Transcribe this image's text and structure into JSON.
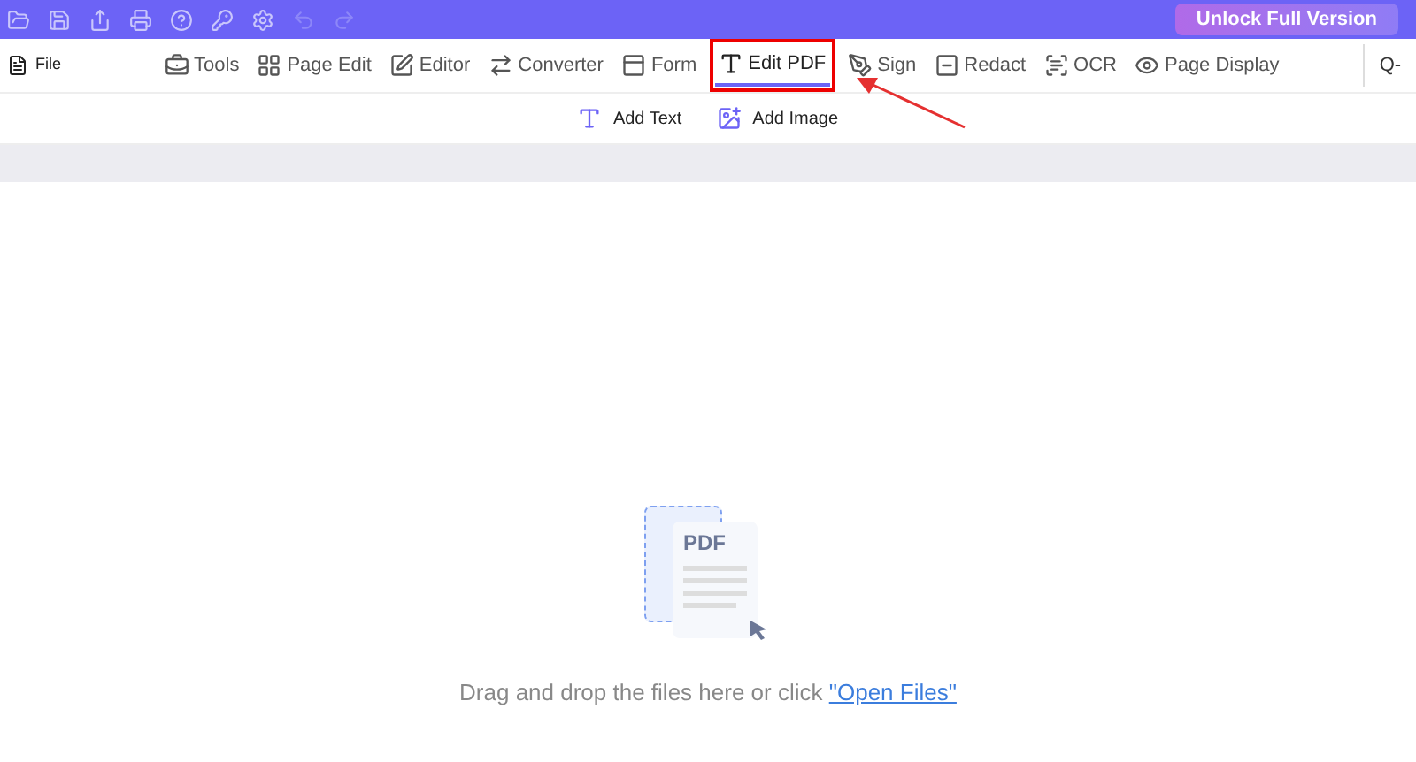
{
  "title_bar": {
    "unlock_button": "Unlock Full Version"
  },
  "file_menu": {
    "label": "File"
  },
  "tabs": [
    {
      "label": "Tools",
      "kind": "tools",
      "selected": false
    },
    {
      "label": "Page Edit",
      "kind": "grid",
      "selected": false
    },
    {
      "label": "Editor",
      "kind": "editor",
      "selected": false
    },
    {
      "label": "Converter",
      "kind": "convert",
      "selected": false
    },
    {
      "label": "Form",
      "kind": "form",
      "selected": false
    },
    {
      "label": "Edit PDF",
      "kind": "text",
      "selected": true
    },
    {
      "label": "Sign",
      "kind": "sign",
      "selected": false
    },
    {
      "label": "Redact",
      "kind": "redact",
      "selected": false
    },
    {
      "label": "OCR",
      "kind": "ocr",
      "selected": false
    },
    {
      "label": "Page Display",
      "kind": "eye",
      "selected": false
    }
  ],
  "zoom_button": {
    "label": "Q-"
  },
  "sub_toolbar": [
    {
      "label": "Add Text",
      "kind": "text"
    },
    {
      "label": "Add Image",
      "kind": "image"
    }
  ],
  "drop_zone": {
    "file_label": "PDF",
    "prompt": "Drag and drop the files here or click ",
    "link": "\"Open Files\""
  }
}
